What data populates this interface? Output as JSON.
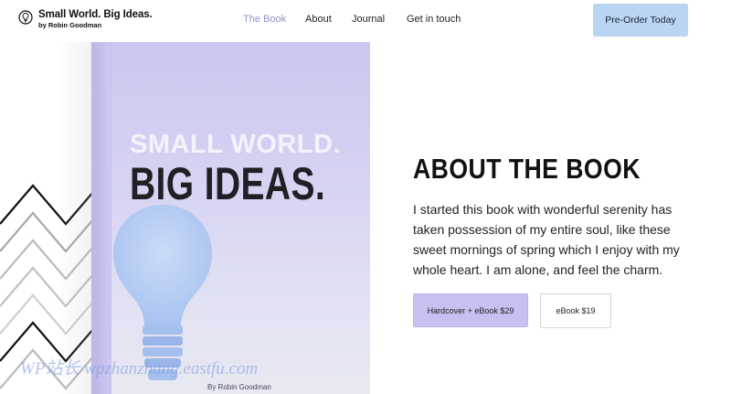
{
  "header": {
    "logo_title": "Small World. Big Ideas.",
    "logo_subtitle": "by Robin Goodman",
    "logo_icon": "brain-lightbulb-icon",
    "nav": [
      {
        "label": "The Book",
        "active": true
      },
      {
        "label": "About",
        "active": false
      },
      {
        "label": "Journal",
        "active": false
      },
      {
        "label": "Get in touch",
        "active": false
      }
    ],
    "cta_label": "Pre-Order Today",
    "cta_color": "#b9d5f3",
    "active_nav_color": "#8c95c8"
  },
  "cover": {
    "line1": "SMALL WORLD.",
    "line2": "BIG IDEAS.",
    "author": "By Robin Goodman",
    "bulb_icon": "lightbulb-icon",
    "bg_color": "#d6d3f3"
  },
  "about": {
    "title": "ABOUT THE BOOK",
    "description": "I started this book with wonderful serenity has taken possession of my entire soul, like these sweet mornings of spring which I enjoy with my whole heart. I am alone, and feel the charm.",
    "buttons": [
      {
        "label": "Hardcover + eBook $29",
        "color": "#c9bff0"
      },
      {
        "label": "eBook $19",
        "color": "#ffffff"
      }
    ]
  },
  "watermark": "WP站长 wpzhanzhang.eastfu.com"
}
